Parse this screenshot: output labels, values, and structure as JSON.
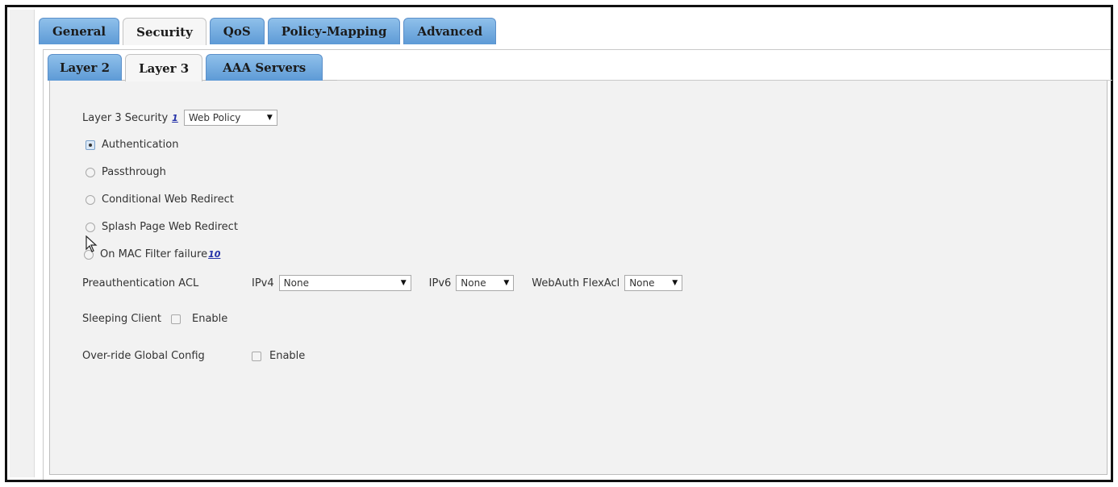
{
  "main_tabs": [
    {
      "label": "General",
      "active": false
    },
    {
      "label": "Security",
      "active": true
    },
    {
      "label": "QoS",
      "active": false
    },
    {
      "label": "Policy-Mapping",
      "active": false
    },
    {
      "label": "Advanced",
      "active": false
    }
  ],
  "sub_tabs": [
    {
      "label": "Layer 2",
      "active": false
    },
    {
      "label": "Layer 3",
      "active": true
    },
    {
      "label": "AAA Servers",
      "active": false
    }
  ],
  "layer3": {
    "label": "Layer 3 Security",
    "footnote": "1",
    "value": "Web Policy"
  },
  "policy_options": [
    {
      "label": "Authentication",
      "checked": true
    },
    {
      "label": "Passthrough",
      "checked": false
    },
    {
      "label": "Conditional Web Redirect",
      "checked": false
    },
    {
      "label": "Splash Page Web Redirect",
      "checked": false
    },
    {
      "label": "On MAC Filter failure",
      "footnote": "10",
      "checked": false
    }
  ],
  "preauth": {
    "label": "Preauthentication ACL",
    "ipv4_label": "IPv4",
    "ipv4_value": "None",
    "ipv6_label": "IPv6",
    "ipv6_value": "None",
    "flexacl_label": "WebAuth FlexAcl",
    "flexacl_value": "None"
  },
  "sleeping_client": {
    "label": "Sleeping Client",
    "enable_label": "Enable",
    "checked": false
  },
  "override": {
    "label": "Over-ride Global Config",
    "enable_label": "Enable",
    "checked": false
  },
  "icons": {
    "dropdown": "triangle-down",
    "cursor": "mouse-pointer-icon"
  }
}
